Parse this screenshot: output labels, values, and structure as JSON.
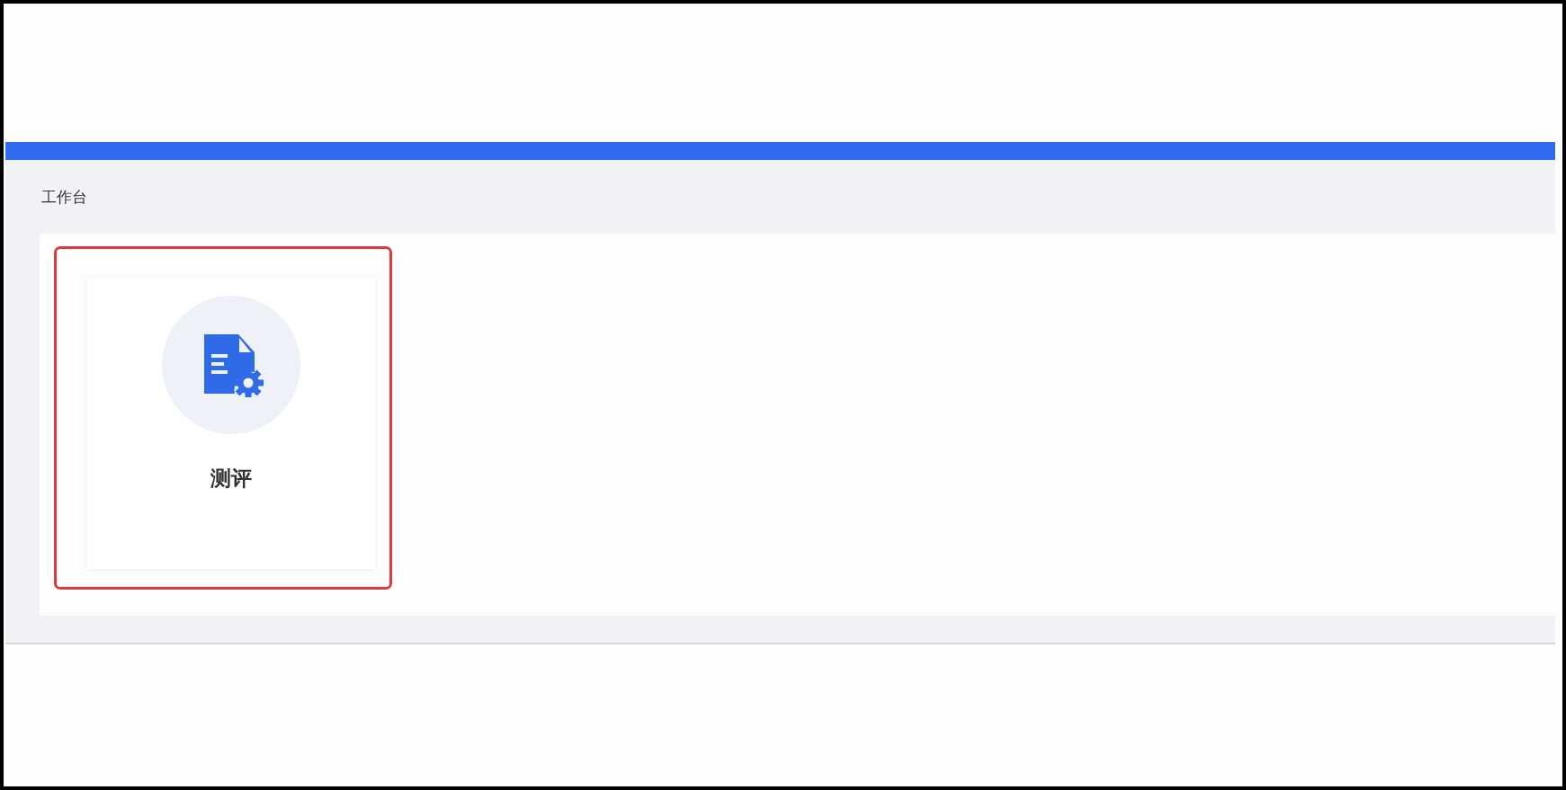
{
  "page_title": "工作台",
  "apps": [
    {
      "label": "测评",
      "highlighted": true
    }
  ]
}
